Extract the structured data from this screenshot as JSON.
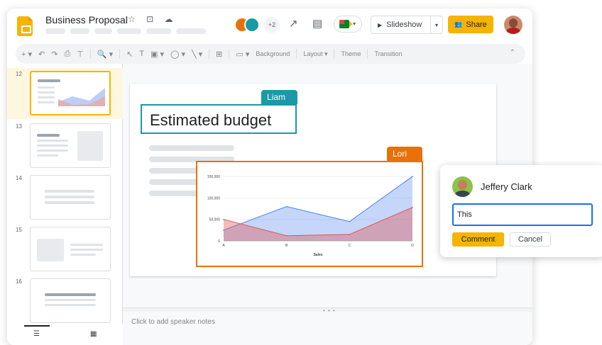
{
  "app": {
    "title": "Business Proposal",
    "title_icons": "☆ ⊡ ☁",
    "avatar_count": "+2",
    "colors": {
      "brand": "#f4b400",
      "accent": "#1a73e8",
      "liam": "#1a9aa6",
      "lori": "#e8710a"
    }
  },
  "header": {
    "trend_icon": "↗",
    "comment_icon": "▤",
    "slideshow_icon": "▶",
    "slideshow_label": "Slideshow",
    "slideshow_caret": "▾",
    "share_icon": "👥",
    "share_label": "Share",
    "meet_caret": "▾"
  },
  "toolbar": {
    "items": [
      "+ ▾",
      "↶",
      "↷",
      "⎙",
      "⊤",
      "🔍 ▾",
      "↖",
      "T",
      "▣ ▾",
      "◯ ▾",
      "╲ ▾",
      "⊞",
      "▭ ▾"
    ],
    "background_label": "Background",
    "layout_label": "Layout ▾",
    "theme_label": "Theme",
    "transition_label": "Transition",
    "collapse_icon": "⌃"
  },
  "filmstrip": {
    "slides": [
      {
        "number": "12"
      },
      {
        "number": "13"
      },
      {
        "number": "14"
      },
      {
        "number": "15"
      },
      {
        "number": "16"
      }
    ],
    "footer_icons": {
      "list": "☰",
      "grid": "▦"
    }
  },
  "slide": {
    "title": "Estimated budget",
    "cursors": {
      "liam": "Liam",
      "lori": "Lori"
    }
  },
  "notes": {
    "placeholder": "Click to add speaker notes",
    "grip": "• • •"
  },
  "comment": {
    "author": "Jeffery Clark",
    "input_value": "This",
    "comment_label": "Comment",
    "cancel_label": "Cancel"
  },
  "chart_data": {
    "type": "area",
    "categories": [
      "A",
      "B",
      "C",
      "D"
    ],
    "series": [
      {
        "name": "",
        "values": [
          25000,
          80000,
          45000,
          150000
        ],
        "color": "#4a7ff0"
      },
      {
        "name": "",
        "values": [
          50000,
          12000,
          15000,
          78000
        ],
        "color": "#e05555"
      }
    ],
    "yticks": [
      "0",
      "50,000",
      "100,000",
      "150,000"
    ],
    "ytick_values": [
      0,
      50000,
      100000,
      150000
    ],
    "ylim": [
      0,
      160000
    ],
    "xlabel": "Sales",
    "ylabel": ""
  }
}
